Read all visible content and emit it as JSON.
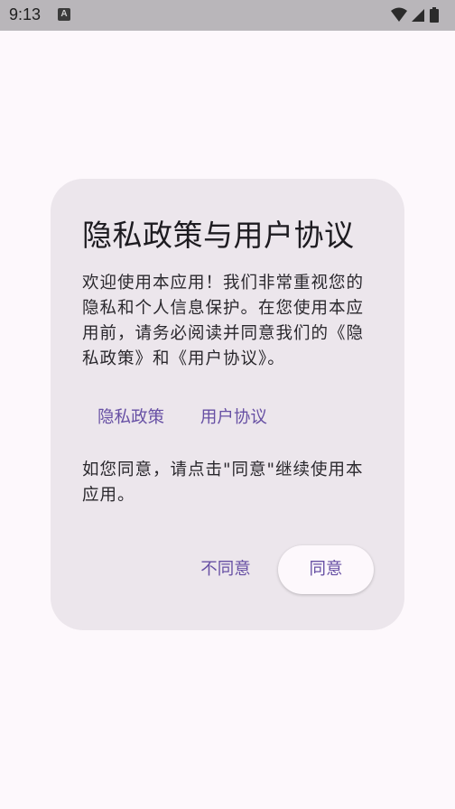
{
  "status_bar": {
    "time": "9:13",
    "notification_letter": "A",
    "icons": [
      "wifi-icon",
      "cellular-signal-icon",
      "battery-icon"
    ]
  },
  "dialog": {
    "title": "隐私政策与用户协议",
    "body": "欢迎使用本应用！我们非常重视您的隐私和个人信息保护。在您使用本应用前，请务必阅读并同意我们的《隐私政策》和《用户协议》。",
    "links": {
      "privacy": "隐私政策",
      "terms": "用户协议"
    },
    "consent_text": "如您同意，请点击\"同意\"继续使用本应用。",
    "buttons": {
      "disagree": "不同意",
      "agree": "同意"
    }
  },
  "colors": {
    "background": "#fdf8fc",
    "dialog_background": "#ece6ec",
    "accent": "#6750a4",
    "text": "#1d1b20",
    "status_bar": "#b9b6ba"
  }
}
